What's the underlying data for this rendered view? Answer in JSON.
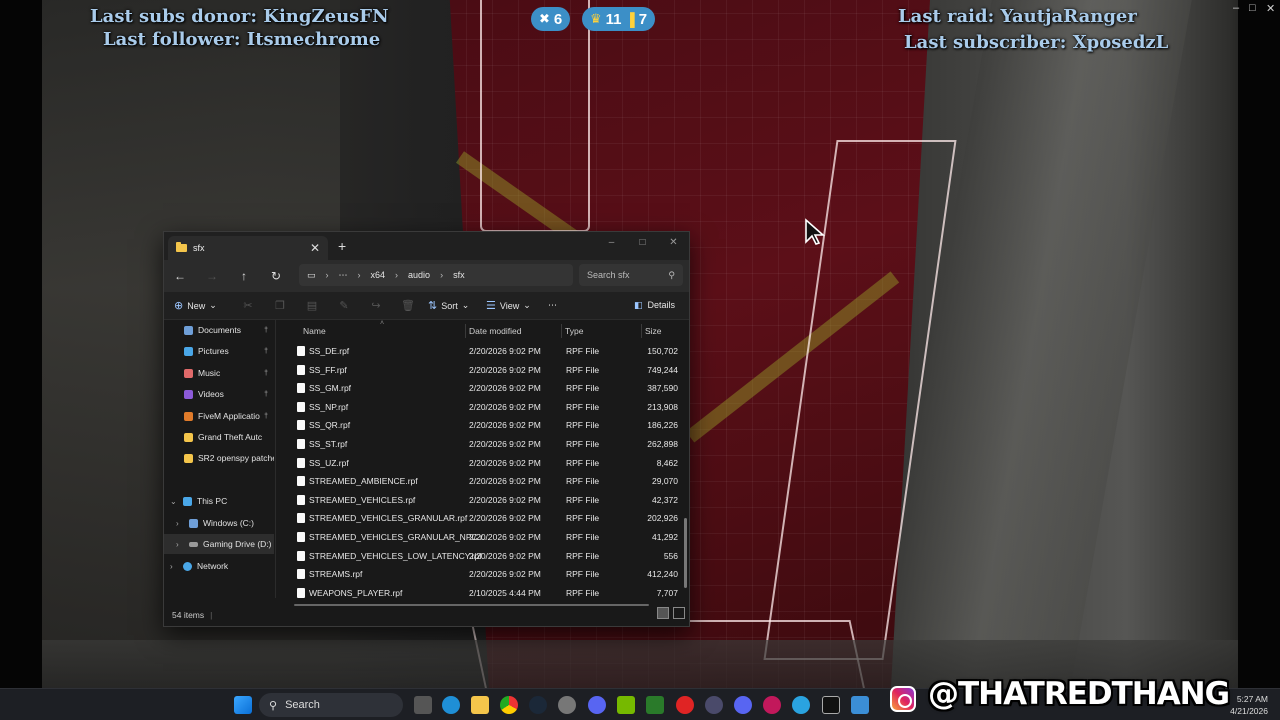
{
  "overlay": {
    "last_subs_donor": "Last subs donor: KingZeusFN",
    "last_follower": "Last follower: Itsmechrome",
    "last_raid": "Last raid: YautjaRanger",
    "last_subscriber": "Last subscriber: XposedzL",
    "stat_a_value": "6",
    "stat_b_value": "11",
    "stat_c_value": "7",
    "brand_handle": "@THATREDTHANG"
  },
  "explorer": {
    "tab_title": "sfx",
    "breadcrumb": [
      "x64",
      "audio",
      "sfx"
    ],
    "search_placeholder": "Search sfx",
    "toolbar": {
      "new_label": "New",
      "sort_label": "Sort",
      "view_label": "View",
      "details_label": "Details"
    },
    "sidebar": {
      "quick_access": [
        {
          "label": "Documents",
          "icon": "documents-icon",
          "color": "#6f9fd8"
        },
        {
          "label": "Pictures",
          "icon": "pictures-icon",
          "color": "#4aa7e8"
        },
        {
          "label": "Music",
          "icon": "music-icon",
          "color": "#e06a6a"
        },
        {
          "label": "Videos",
          "icon": "videos-icon",
          "color": "#8c5ad8"
        },
        {
          "label": "FiveM Applicatio",
          "icon": "fivem-icon",
          "color": "#e07b2a"
        },
        {
          "label": "Grand Theft Autc",
          "icon": "folder-icon",
          "color": "#f4c54b"
        },
        {
          "label": "SR2 openspy patche",
          "icon": "folder-icon",
          "color": "#f4c54b"
        }
      ],
      "this_pc_label": "This PC",
      "drives": [
        {
          "label": "Windows (C:)",
          "icon": "drive-c-icon"
        },
        {
          "label": "Gaming Drive (D:)",
          "icon": "drive-d-icon"
        }
      ],
      "network_label": "Network"
    },
    "columns": {
      "name": "Name",
      "date": "Date modified",
      "type": "Type",
      "size": "Size"
    },
    "files": [
      {
        "name": "SS_DE.rpf",
        "date": "2/20/2026 9:02 PM",
        "type": "RPF File",
        "size": "150,702"
      },
      {
        "name": "SS_FF.rpf",
        "date": "2/20/2026 9:02 PM",
        "type": "RPF File",
        "size": "749,244"
      },
      {
        "name": "SS_GM.rpf",
        "date": "2/20/2026 9:02 PM",
        "type": "RPF File",
        "size": "387,590"
      },
      {
        "name": "SS_NP.rpf",
        "date": "2/20/2026 9:02 PM",
        "type": "RPF File",
        "size": "213,908"
      },
      {
        "name": "SS_QR.rpf",
        "date": "2/20/2026 9:02 PM",
        "type": "RPF File",
        "size": "186,226"
      },
      {
        "name": "SS_ST.rpf",
        "date": "2/20/2026 9:02 PM",
        "type": "RPF File",
        "size": "262,898"
      },
      {
        "name": "SS_UZ.rpf",
        "date": "2/20/2026 9:02 PM",
        "type": "RPF File",
        "size": "8,462"
      },
      {
        "name": "STREAMED_AMBIENCE.rpf",
        "date": "2/20/2026 9:02 PM",
        "type": "RPF File",
        "size": "29,070"
      },
      {
        "name": "STREAMED_VEHICLES.rpf",
        "date": "2/20/2026 9:02 PM",
        "type": "RPF File",
        "size": "42,372"
      },
      {
        "name": "STREAMED_VEHICLES_GRANULAR.rpf",
        "date": "2/20/2026 9:02 PM",
        "type": "RPF File",
        "size": "202,926"
      },
      {
        "name": "STREAMED_VEHICLES_GRANULAR_NPC.r...",
        "date": "2/20/2026 9:02 PM",
        "type": "RPF File",
        "size": "41,292"
      },
      {
        "name": "STREAMED_VEHICLES_LOW_LATENCY.rpf",
        "date": "2/20/2026 9:02 PM",
        "type": "RPF File",
        "size": "556"
      },
      {
        "name": "STREAMS.rpf",
        "date": "2/20/2026 9:02 PM",
        "type": "RPF File",
        "size": "412,240"
      },
      {
        "name": "WEAPONS_PLAYER.rpf",
        "date": "2/10/2025 4:44 PM",
        "type": "RPF File",
        "size": "7,707"
      }
    ],
    "status_items": "54 items"
  },
  "taskbar": {
    "search_label": "Search",
    "time": "5:27 AM",
    "date": "4/21/2026"
  }
}
